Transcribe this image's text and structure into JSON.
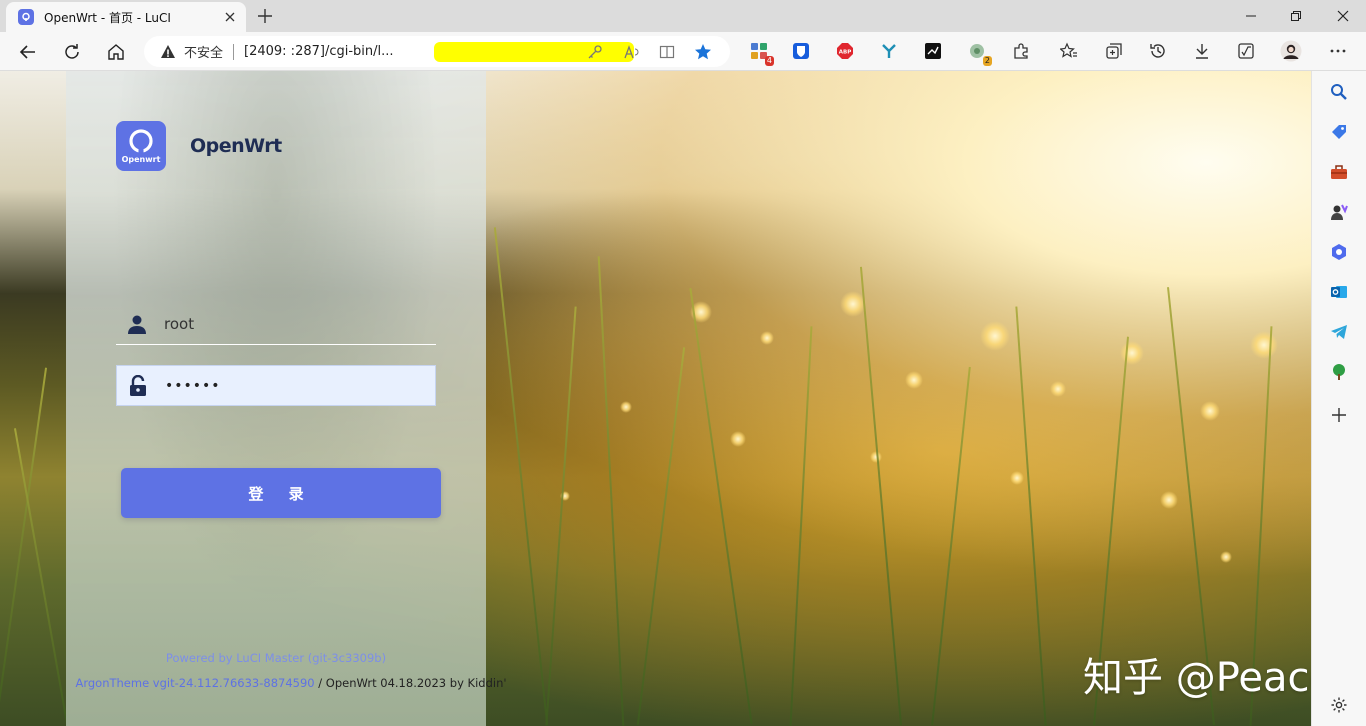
{
  "browser": {
    "tab_title": "OpenWrt - 首页 - LuCI",
    "address": {
      "security_label": "不安全",
      "url": "[2409:                                 :287]/cgi-bin/l..."
    },
    "colors": {
      "accent": "#5e72e4",
      "chrome": "#f7f7f7",
      "tabstrip": "#dcdcdc"
    },
    "toolbar_icons": [
      "back-icon",
      "refresh-icon",
      "home-icon",
      "key-icon",
      "read-aloud-icon",
      "split-screen-icon",
      "favorite-star-icon"
    ],
    "extensions": [
      {
        "name": "ext-collections-icon",
        "badge": "4"
      },
      {
        "name": "ext-bitwarden-icon",
        "badge": ""
      },
      {
        "name": "ext-adblock-icon",
        "badge": ""
      },
      {
        "name": "ext-fork-icon",
        "badge": ""
      },
      {
        "name": "ext-terminal-icon",
        "badge": ""
      },
      {
        "name": "ext-circle-icon",
        "badge": "2"
      }
    ]
  },
  "login": {
    "brand": "OpenWrt",
    "logo_text": "Openwrt",
    "username_value": "root",
    "password_mask": "••••••",
    "login_label": "登 录",
    "footer_powered": "Powered by LuCI Master (git-3c3309b)",
    "footer_theme_link": "ArgonTheme vgit-24.112.76633-8874590",
    "footer_tail": " / OpenWrt 04.18.2023 by Kiddin'"
  },
  "watermark": "知乎 @Peace",
  "sidebar": [
    "search-icon",
    "shopping-tag-icon",
    "toolbox-icon",
    "games-icon",
    "copilot-icon",
    "outlook-icon",
    "telegram-icon",
    "tree-icon",
    "add-icon",
    "settings-icon"
  ]
}
